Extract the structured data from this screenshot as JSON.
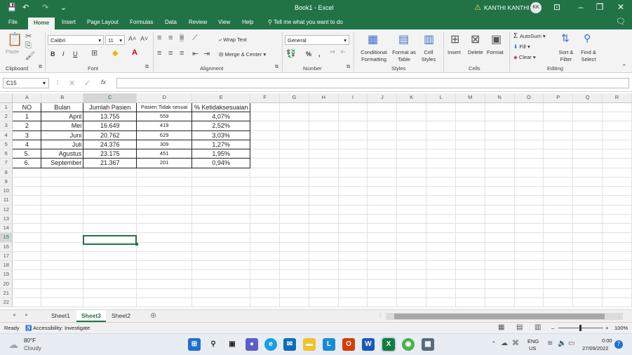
{
  "app": {
    "title": "Book1 - Excel",
    "user": "KANTHI KANTHI",
    "user_initials": "KK",
    "accent": "#217346"
  },
  "tabs": [
    "File",
    "Home",
    "Insert",
    "Page Layout",
    "Formulas",
    "Data",
    "Review",
    "View",
    "Help"
  ],
  "tell_me": "Tell me what you want to do",
  "ribbon": {
    "clipboard": {
      "paste": "Paste",
      "label": "Clipboard"
    },
    "font": {
      "name": "Calibri",
      "size": "11",
      "label": "Font",
      "bold": "B",
      "italic": "I",
      "underline": "U"
    },
    "alignment": {
      "wrap": "Wrap Text",
      "merge": "Merge & Center",
      "label": "Alignment"
    },
    "number": {
      "format": "General",
      "label": "Number",
      "percent": "%",
      "comma": ","
    },
    "styles": {
      "conditional": "Conditional Formatting",
      "format_table": "Format as Table",
      "cell_styles": "Cell Styles",
      "label": "Styles"
    },
    "cells": {
      "insert": "Insert",
      "delete": "Delete",
      "format": "Format",
      "label": "Cells"
    },
    "editing": {
      "autosum": "AutoSum",
      "fill": "Fill",
      "clear": "Clear",
      "sort": "Sort & Filter",
      "find": "Find & Select",
      "label": "Editing"
    }
  },
  "formula_bar": {
    "name_box": "C15",
    "fx": "fx",
    "value": ""
  },
  "columns": [
    "A",
    "B",
    "C",
    "D",
    "E",
    "F",
    "G",
    "H",
    "I",
    "J",
    "K",
    "L",
    "M",
    "N",
    "O",
    "P",
    "Q",
    "R"
  ],
  "rows": [
    "1",
    "2",
    "3",
    "4",
    "5",
    "6",
    "7",
    "8",
    "9",
    "10",
    "11",
    "12",
    "13",
    "14",
    "15",
    "16",
    "17",
    "18",
    "19",
    "20",
    "21",
    "22"
  ],
  "table": {
    "headers": [
      "NO",
      "Bulan",
      "Jumlah Pasien",
      "Pasien Tidak sesuai",
      "% Ketidaksesuaian"
    ],
    "rows": [
      [
        "1",
        "April",
        "13.755",
        "559",
        "4,07%"
      ],
      [
        "2",
        "Mei",
        "16.649",
        "419",
        "2,52%"
      ],
      [
        "3",
        "Juni",
        "20.762",
        "629",
        "3,03%"
      ],
      [
        "4",
        "Juli",
        "24.376",
        "309",
        "1,27%"
      ],
      [
        "5.",
        "Agustus",
        "23.175",
        "451",
        "1,95%"
      ],
      [
        "6.",
        "September",
        "21.367",
        "201",
        "0,94%"
      ]
    ]
  },
  "sheets": [
    "Sheet1",
    "Sheet3",
    "Sheet2"
  ],
  "active_sheet": "Sheet3",
  "status": {
    "ready": "Ready",
    "accessibility": "Accessibility: Investigate",
    "zoom": "100%"
  },
  "taskbar": {
    "weather_temp": "80°F",
    "weather_desc": "Cloudy",
    "lang": "ENG",
    "region": "US",
    "time": "0:00",
    "date": "27/09/2022"
  }
}
